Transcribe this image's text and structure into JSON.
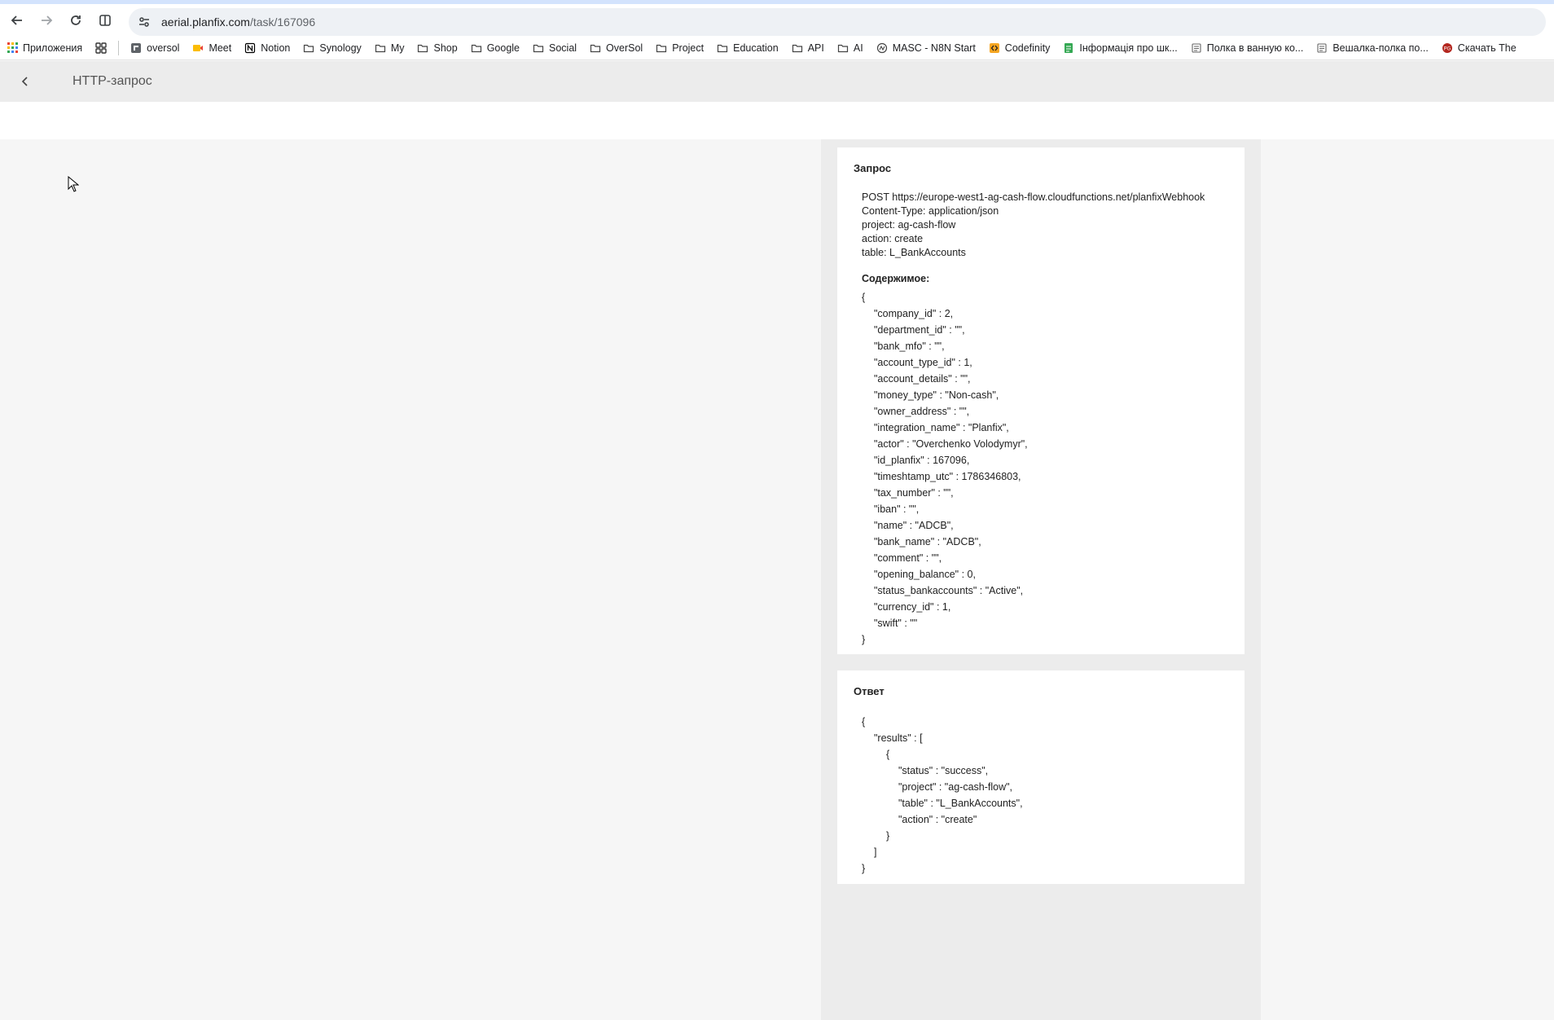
{
  "browser": {
    "url_host": "aerial.planfix.com",
    "url_path": "/task/167096"
  },
  "bookmarks": [
    {
      "label": "Приложения",
      "icon": "apps-grid-icon"
    },
    {
      "label": "",
      "icon": "grid-icon"
    },
    {
      "label": "oversol",
      "icon": "favicon-oversol"
    },
    {
      "label": "Meet",
      "icon": "meet-icon"
    },
    {
      "label": "Notion",
      "icon": "notion-icon"
    },
    {
      "label": "Synology",
      "icon": "folder-icon"
    },
    {
      "label": "My",
      "icon": "folder-icon"
    },
    {
      "label": "Shop",
      "icon": "folder-icon"
    },
    {
      "label": "Google",
      "icon": "folder-icon"
    },
    {
      "label": "Social",
      "icon": "folder-icon"
    },
    {
      "label": "OverSol",
      "icon": "folder-icon"
    },
    {
      "label": "Project",
      "icon": "folder-icon"
    },
    {
      "label": "Education",
      "icon": "folder-icon"
    },
    {
      "label": "API",
      "icon": "folder-icon"
    },
    {
      "label": "AI",
      "icon": "folder-icon"
    },
    {
      "label": "MASC - N8N Start",
      "icon": "n8n-icon"
    },
    {
      "label": "Codefinity",
      "icon": "codefinity-icon"
    },
    {
      "label": "Інформація про шк...",
      "icon": "sheet-icon"
    },
    {
      "label": "Полка в ванную ко...",
      "icon": "page-icon"
    },
    {
      "label": "Вешалка-полка по...",
      "icon": "page-icon"
    },
    {
      "label": "Скачать The",
      "icon": "red-badge-icon"
    }
  ],
  "header": {
    "title": "HTTP-запрос"
  },
  "request": {
    "title": "Запрос",
    "lines": [
      "POST https://europe-west1-ag-cash-flow.cloudfunctions.net/planfixWebhook",
      "Content-Type: application/json",
      "project: ag-cash-flow",
      "action: create",
      "table: L_BankAccounts"
    ],
    "body_title": "Содержимое:",
    "body_open": "{",
    "body_lines": [
      "\"company_id\" : 2,",
      "\"department_id\" : \"\",",
      "\"bank_mfo\" : \"\",",
      "\"account_type_id\" : 1,",
      "\"account_details\" : \"\",",
      "\"money_type\" : \"Non-cash\",",
      "\"owner_address\" : \"\",",
      "\"integration_name\" : \"Planfix\",",
      "\"actor\" : \"Overchenko Volodymyr\",",
      "\"id_planfix\" : 167096,",
      "\"timeshtamp_utc\" : 1786346803,",
      "\"tax_number\" : \"\",",
      "\"iban\" : \"\",",
      "\"name\" : \"ADCB\",",
      "\"bank_name\" : \"ADCB\",",
      "\"comment\" : \"\",",
      "\"opening_balance\" : 0,",
      "\"status_bankaccounts\" : \"Active\",",
      "\"currency_id\" : 1,",
      "\"swift\" : \"\""
    ],
    "body_close": "}"
  },
  "response": {
    "title": "Ответ",
    "lines": [
      {
        "text": "{",
        "indent": 0
      },
      {
        "text": "\"results\" : [",
        "indent": 1
      },
      {
        "text": "{",
        "indent": 2
      },
      {
        "text": "\"status\" : \"success\",",
        "indent": 3
      },
      {
        "text": "\"project\" : \"ag-cash-flow\",",
        "indent": 3
      },
      {
        "text": "\"table\" : \"L_BankAccounts\",",
        "indent": 3
      },
      {
        "text": "\"action\" : \"create\"",
        "indent": 3
      },
      {
        "text": "}",
        "indent": 2
      },
      {
        "text": "]",
        "indent": 1
      },
      {
        "text": "}",
        "indent": 0
      }
    ]
  },
  "colors": {
    "accent": "#d3e3fd",
    "page_bg": "#f6f6f6",
    "header_bg": "#ececec"
  }
}
